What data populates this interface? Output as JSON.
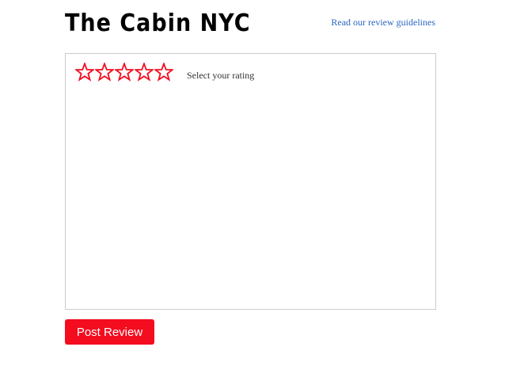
{
  "header": {
    "business_name": "The Cabin NYC",
    "guidelines_link": "Read our review guidelines"
  },
  "review_form": {
    "rating": {
      "max_stars": 5,
      "selected": 0,
      "hint": "Select your rating",
      "star_color": "#f40c1f",
      "star_icon": "star-outline-icon"
    },
    "text": {
      "value": "",
      "placeholder": ""
    },
    "submit_label": "Post Review"
  },
  "colors": {
    "accent": "#f40c1f",
    "link": "#2866c2",
    "box_border": "#cccccc"
  }
}
